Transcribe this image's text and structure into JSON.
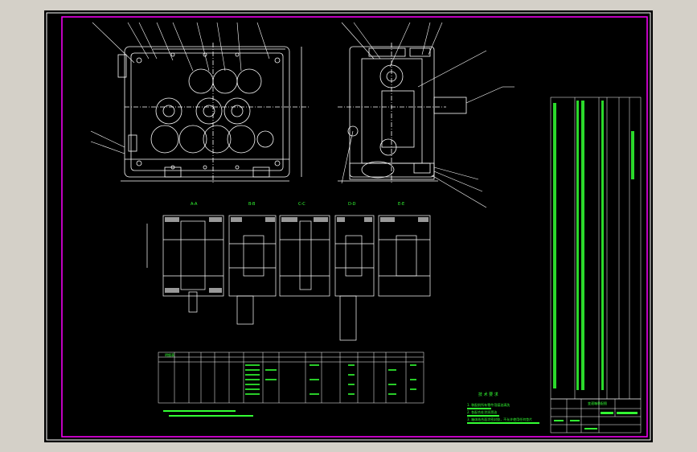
{
  "drawing": {
    "background": "#000000",
    "frame_color": "#ff00ff",
    "line_color": "#ffffff",
    "text_color": "#33ff33",
    "leader_color": "#ffffff",
    "section_marks": [
      "A-A",
      "B-B",
      "C-C",
      "D-D",
      "E-E"
    ],
    "notes_title": "技 术 要 求",
    "notes": [
      "1. 装配前所有零件用煤油清洗",
      "2. 各配合处涂润滑油",
      "3. 箱体结合面涂密封胶，不允许使用任何垫片"
    ],
    "parts_table_title": "明细表",
    "title_block": "变速箱装配图"
  }
}
